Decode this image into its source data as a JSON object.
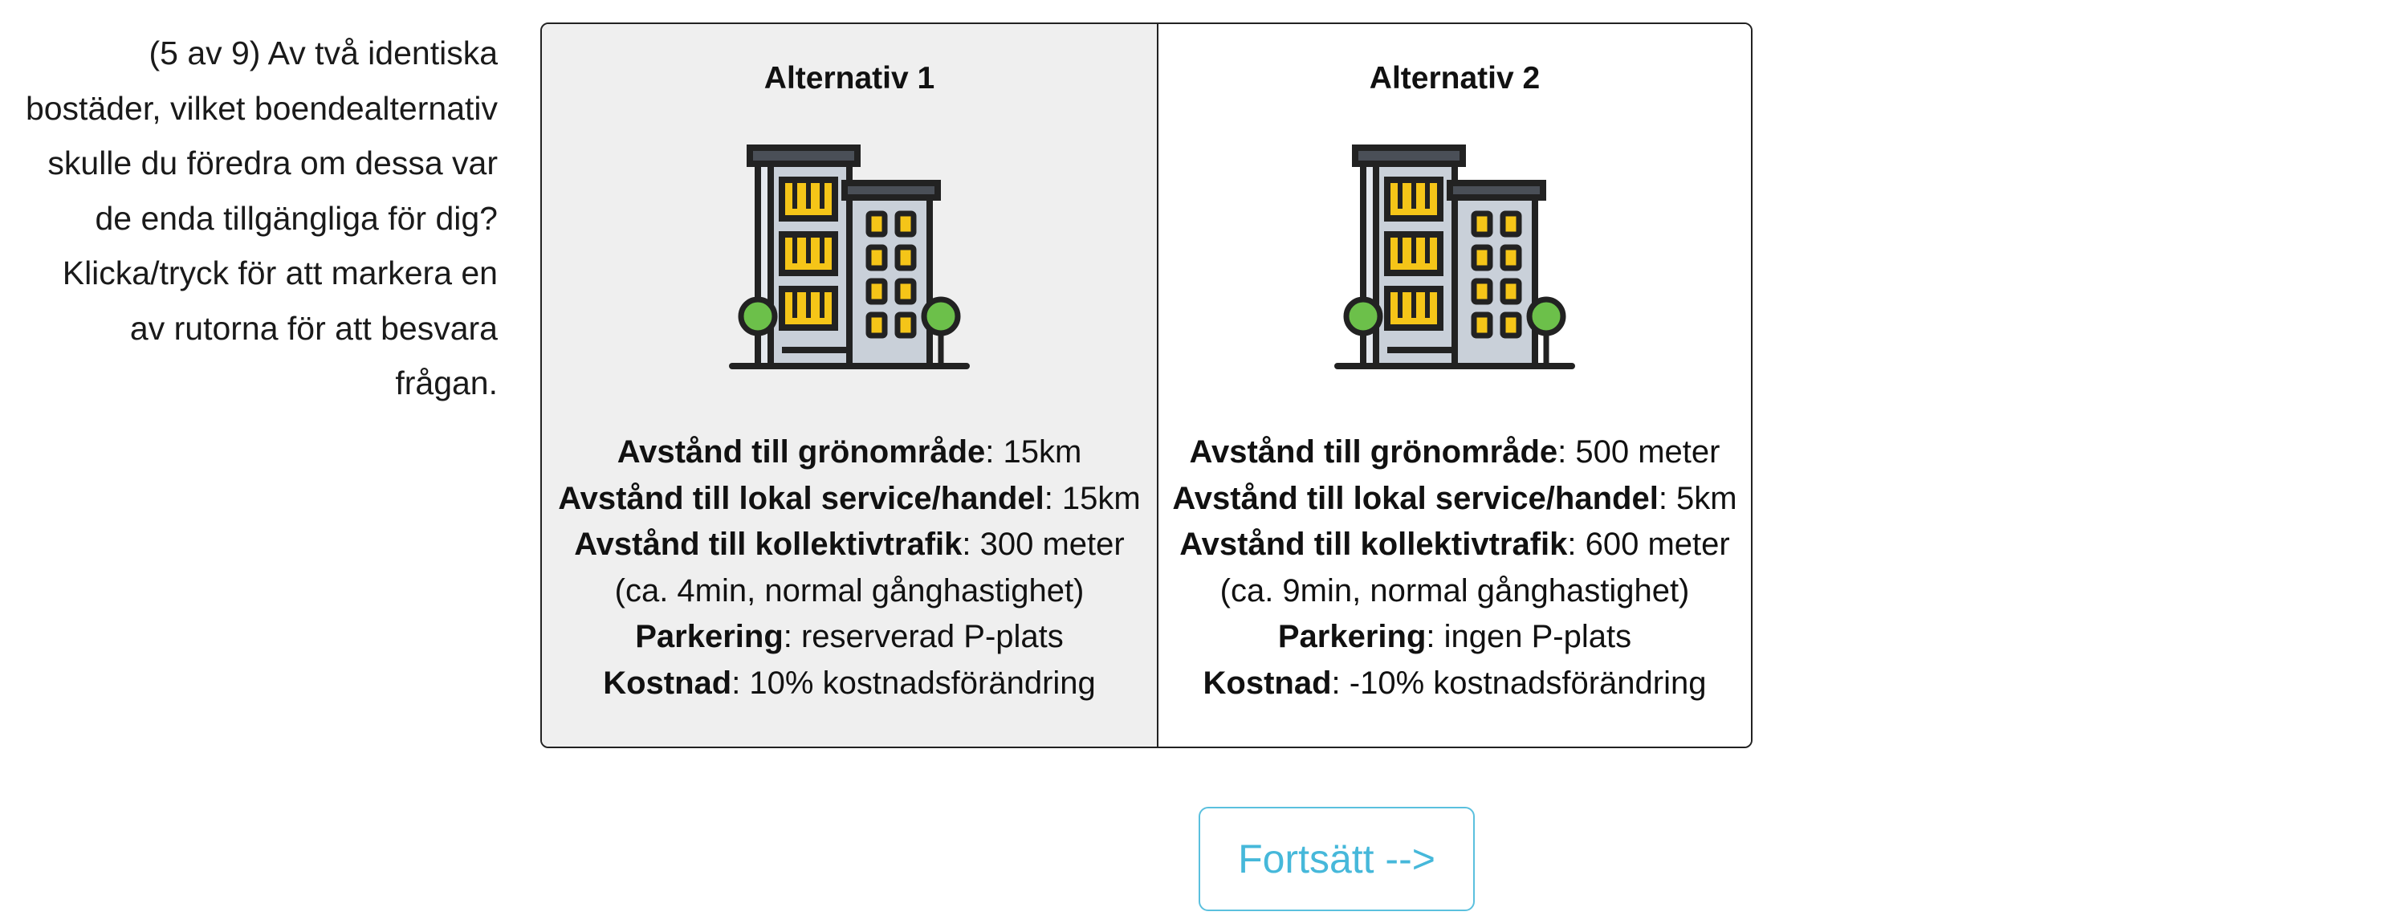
{
  "question": "(5 av 9) Av två identiska bostäder, vilket boendealternativ skulle du föredra om dessa var de enda tillgängliga för dig? Klicka/tryck för att markera en av rutorna för att besvara frågan.",
  "alternatives": [
    {
      "title": "Alternativ 1",
      "icon": "apartment-building-icon",
      "selected": true,
      "attributes": {
        "green_label": "Avstånd till grönområde",
        "green_value": ": 15km",
        "service_label": "Avstånd till lokal service/handel",
        "service_value": ": 15km",
        "transit_label": "Avstånd till kollektivtrafik",
        "transit_value": ": 300 meter",
        "transit_note": "(ca. 4min, normal gånghastighet)",
        "parking_label": "Parkering",
        "parking_value": ": reserverad P-plats",
        "cost_label": "Kostnad",
        "cost_value": ": 10% kostnadsförändring"
      }
    },
    {
      "title": "Alternativ 2",
      "icon": "apartment-building-icon",
      "selected": false,
      "attributes": {
        "green_label": "Avstånd till grönområde",
        "green_value": ": 500 meter",
        "service_label": "Avstånd till lokal service/handel",
        "service_value": ": 5km",
        "transit_label": "Avstånd till kollektivtrafik",
        "transit_value": ": 600 meter",
        "transit_note": "(ca. 9min, normal gånghastighet)",
        "parking_label": "Parkering",
        "parking_value": ": ingen P-plats",
        "cost_label": "Kostnad",
        "cost_value": ": -10% kostnadsförändring"
      }
    }
  ],
  "continue_label": "Fortsätt -->",
  "colors": {
    "selected_bg": "#efefef",
    "button_accent": "#5bc0de",
    "window_yellow": "#f5c518",
    "building_gray": "#c9d0d9",
    "tree_green": "#6cc04a"
  }
}
